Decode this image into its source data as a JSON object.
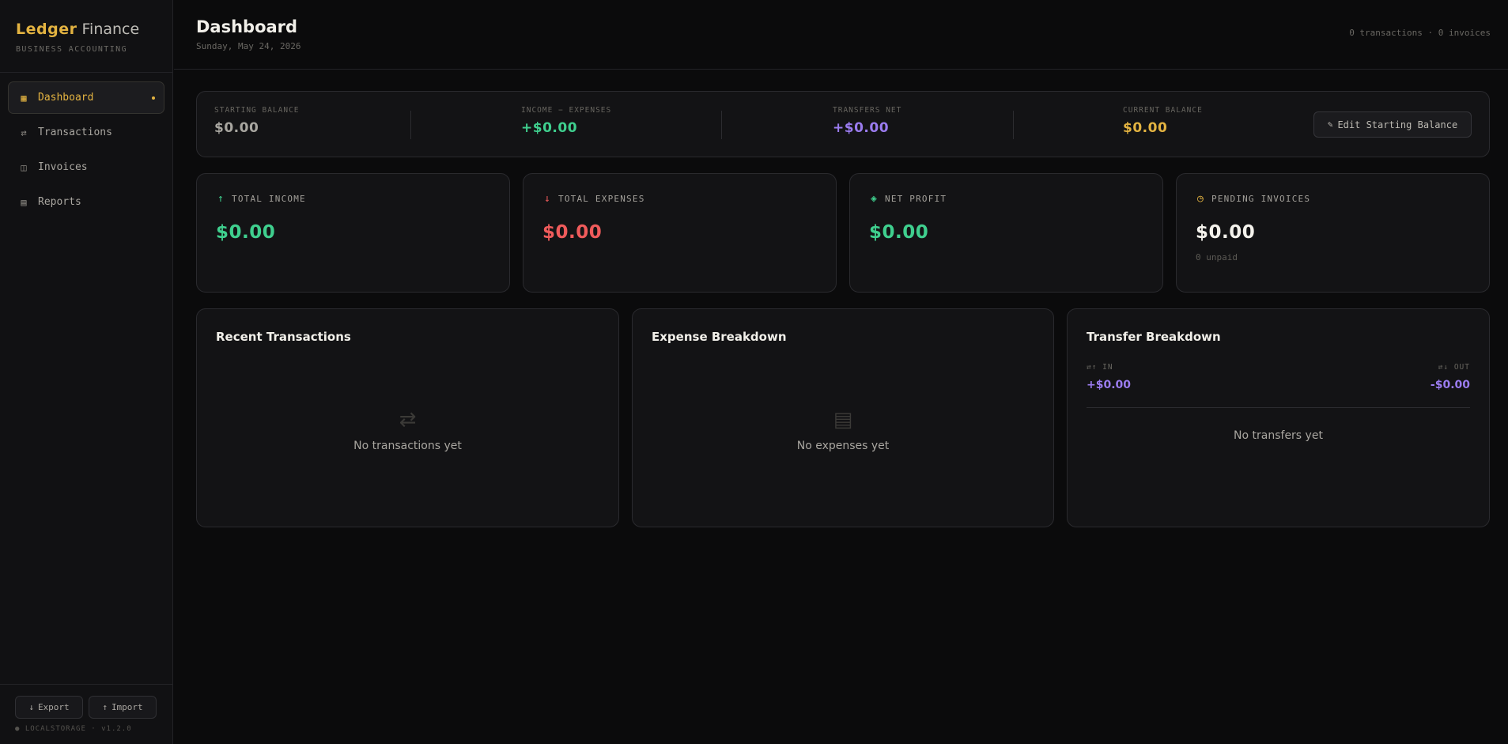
{
  "brand": {
    "name_primary": "Ledger",
    "name_secondary": "Finance",
    "subtitle": "BUSINESS ACCOUNTING"
  },
  "nav": {
    "items": [
      {
        "label": "Dashboard",
        "icon": "grid-icon",
        "glyph": "▦",
        "active": true
      },
      {
        "label": "Transactions",
        "icon": "swap-icon",
        "glyph": "⇄",
        "active": false
      },
      {
        "label": "Invoices",
        "icon": "columns-icon",
        "glyph": "◫",
        "active": false
      },
      {
        "label": "Reports",
        "icon": "list-icon",
        "glyph": "▤",
        "active": false
      }
    ]
  },
  "sidebar_footer": {
    "export_label": "Export",
    "export_glyph": "↓",
    "import_label": "Import",
    "import_glyph": "↑",
    "version": "● LOCALSTORAGE · v1.2.0"
  },
  "header": {
    "title": "Dashboard",
    "date": "Sunday, May 24, 2026",
    "stats": "0 transactions · 0 invoices"
  },
  "balance": {
    "items": [
      {
        "label": "STARTING BALANCE",
        "value": "$0.00",
        "color": "#a8a6a0"
      },
      {
        "label": "INCOME − EXPENSES",
        "value": "+$0.00",
        "color": "#3fcf8e"
      },
      {
        "label": "TRANSFERS NET",
        "value": "+$0.00",
        "color": "#9b7cf0"
      },
      {
        "label": "CURRENT BALANCE",
        "value": "$0.00",
        "color": "#e3b341"
      }
    ],
    "edit_glyph": "✎",
    "edit_label": "Edit Starting Balance"
  },
  "stats": [
    {
      "label": "TOTAL INCOME",
      "value": "$0.00",
      "glyph": "↑",
      "icon": "arrow-up-icon",
      "color": "#3fcf8e",
      "sub": ""
    },
    {
      "label": "TOTAL EXPENSES",
      "value": "$0.00",
      "glyph": "↓",
      "icon": "arrow-down-icon",
      "color": "#ef5b5b",
      "sub": ""
    },
    {
      "label": "NET PROFIT",
      "value": "$0.00",
      "glyph": "◈",
      "icon": "diamond-icon",
      "color": "#3fcf8e",
      "sub": ""
    },
    {
      "label": "PENDING INVOICES",
      "value": "$0.00",
      "glyph": "◷",
      "icon": "clock-icon",
      "color": "#f4f2ec",
      "icon_color": "#e3b341",
      "sub": "0 unpaid"
    }
  ],
  "panels": {
    "recent": {
      "title": "Recent Transactions",
      "empty_glyph": "⇄",
      "empty_text": "No transactions yet"
    },
    "expense": {
      "title": "Expense Breakdown",
      "empty_glyph": "▤",
      "empty_text": "No expenses yet"
    },
    "transfer": {
      "title": "Transfer Breakdown",
      "in_label": "⇄↑ IN",
      "in_value": "+$0.00",
      "out_label": "⇄↓ OUT",
      "out_value": "-$0.00",
      "empty_text": "No transfers yet"
    }
  }
}
